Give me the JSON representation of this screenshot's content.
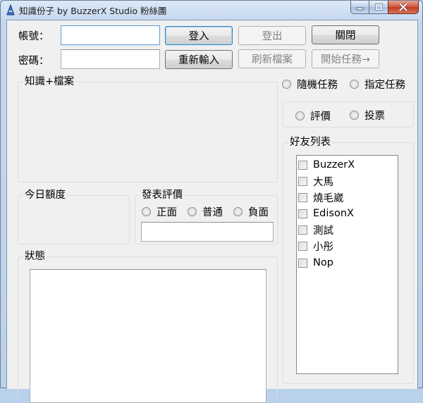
{
  "window": {
    "title": "知識份子 by BuzzerX Studio 粉絲團",
    "icons": {
      "app": "app-icon",
      "minimize": "minimize-icon",
      "maximize": "maximize-icon",
      "close": "close-icon"
    },
    "close_color": "#c13b1f"
  },
  "login": {
    "account_label": "帳號：",
    "password_label": "密碼：",
    "account_value": "",
    "password_value": ""
  },
  "buttons": {
    "login": "登入",
    "logout": "登出",
    "close": "關閉",
    "reenter": "重新輸入",
    "refresh": "刷新檔案",
    "start": "開始任務→"
  },
  "groups": {
    "knowledge": "知識+檔案",
    "quota": "今日額度",
    "publish": "發表評價",
    "status": "狀態",
    "friends": "好友列表"
  },
  "task_mode": {
    "options": [
      "隨機任務",
      "指定任務"
    ]
  },
  "action_mode": {
    "options": [
      "評價",
      "投票"
    ]
  },
  "rating": {
    "options": [
      "正面",
      "普通",
      "負面"
    ],
    "value": ""
  },
  "friends": [
    "BuzzerX",
    "大馬",
    "燒毛崴",
    "EdisonX",
    "測試",
    "小彤",
    "Nop"
  ]
}
